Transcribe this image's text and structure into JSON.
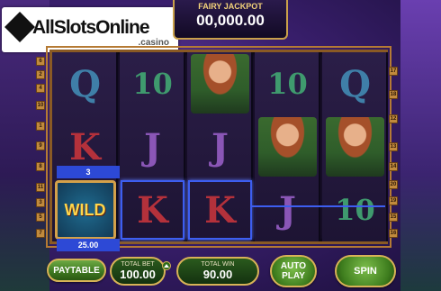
{
  "logo": {
    "brand": "AllSlotsOnline",
    "suffix": ".casino"
  },
  "jackpot": {
    "title": "FAIRY JACKPOT",
    "amount": "00,000.00"
  },
  "reels": [
    [
      "Q",
      "K",
      "WILD"
    ],
    [
      "10",
      "J",
      "K"
    ],
    [
      "fairy",
      "J",
      "K"
    ],
    [
      "10",
      "fairy",
      "J"
    ],
    [
      "Q",
      "fairy",
      "10"
    ]
  ],
  "win": {
    "line_number": "3",
    "amount": "25.00"
  },
  "paylines_left": [
    "6",
    "2",
    "4",
    "10",
    "1",
    "9",
    "8",
    "11",
    "3",
    "5",
    "7"
  ],
  "paylines_right": [
    "17",
    "18",
    "12",
    "13",
    "14",
    "20",
    "19",
    "15",
    "16"
  ],
  "controls": {
    "paytable": "PAYTABLE",
    "total_bet_label": "TOTAL BET",
    "total_bet_value": "100.00",
    "total_win_label": "TOTAL WIN",
    "total_win_value": "90.00",
    "autoplay_line1": "AUTO",
    "autoplay_line2": "PLAY",
    "spin": "SPIN"
  },
  "colors": {
    "win_highlight": "#3d5ef0",
    "button_green": "#3f7a21",
    "gold": "#d8b357"
  }
}
